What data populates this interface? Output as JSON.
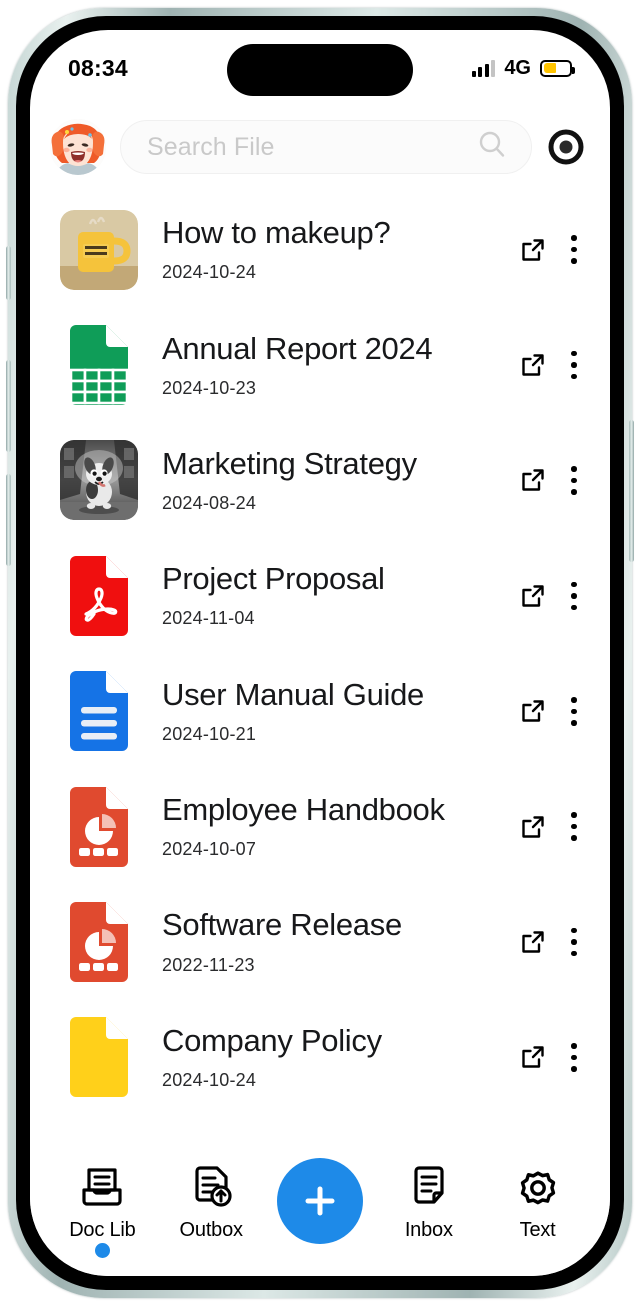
{
  "status_bar": {
    "time": "08:34",
    "network_label": "4G",
    "signal_icon": "signal-bars-icon",
    "battery_icon": "battery-icon",
    "battery_level_percent": 45,
    "battery_color": "#FFC400"
  },
  "header": {
    "avatar_name": "user-avatar",
    "search": {
      "placeholder": "Search File",
      "value": "",
      "icon": "search-icon"
    },
    "record_button_icon": "record-target-icon"
  },
  "files": {
    "share_icon": "external-link-icon",
    "menu_icon": "more-vertical-icon",
    "items": [
      {
        "name": "How to makeup?",
        "date": "2024-10-24",
        "icon": "image-thumbnail-mug",
        "icon_type": "photo-mug",
        "color": "#E8B93B"
      },
      {
        "name": "Annual Report 2024",
        "date": "2024-10-23",
        "icon": "spreadsheet-file-icon",
        "icon_type": "sheet",
        "color": "#0F9D58"
      },
      {
        "name": "Marketing Strategy",
        "date": "2024-08-24",
        "icon": "image-thumbnail-dog",
        "icon_type": "photo-dog",
        "color": "#6b6b6b"
      },
      {
        "name": "Project Proposal",
        "date": "2024-11-04",
        "icon": "pdf-file-icon",
        "icon_type": "pdf",
        "color": "#F00F0F"
      },
      {
        "name": "User Manual Guide",
        "date": "2024-10-21",
        "icon": "document-file-icon",
        "icon_type": "doc",
        "color": "#1573E6"
      },
      {
        "name": "Employee Handbook",
        "date": "2024-10-07",
        "icon": "presentation-file-icon",
        "icon_type": "ppt",
        "color": "#E04A2F"
      },
      {
        "name": "Software Release",
        "date": "2022-11-23",
        "icon": "presentation-file-icon",
        "icon_type": "ppt",
        "color": "#E04A2F"
      },
      {
        "name": "Company Policy",
        "date": "2024-10-24",
        "icon": "generic-file-icon",
        "icon_type": "blank",
        "color": "#FFD01A"
      }
    ]
  },
  "tabbar": {
    "accent_color": "#1e8ae8",
    "items": [
      {
        "label": "Doc Lib",
        "icon": "doc-library-icon",
        "active": true
      },
      {
        "label": "Outbox",
        "icon": "outbox-upload-icon",
        "active": false
      },
      {
        "label": "Inbox",
        "icon": "inbox-document-icon",
        "active": false
      },
      {
        "label": "Text",
        "icon": "gear-settings-icon",
        "active": false
      }
    ],
    "fab": {
      "label": "+",
      "icon": "plus-icon"
    }
  }
}
